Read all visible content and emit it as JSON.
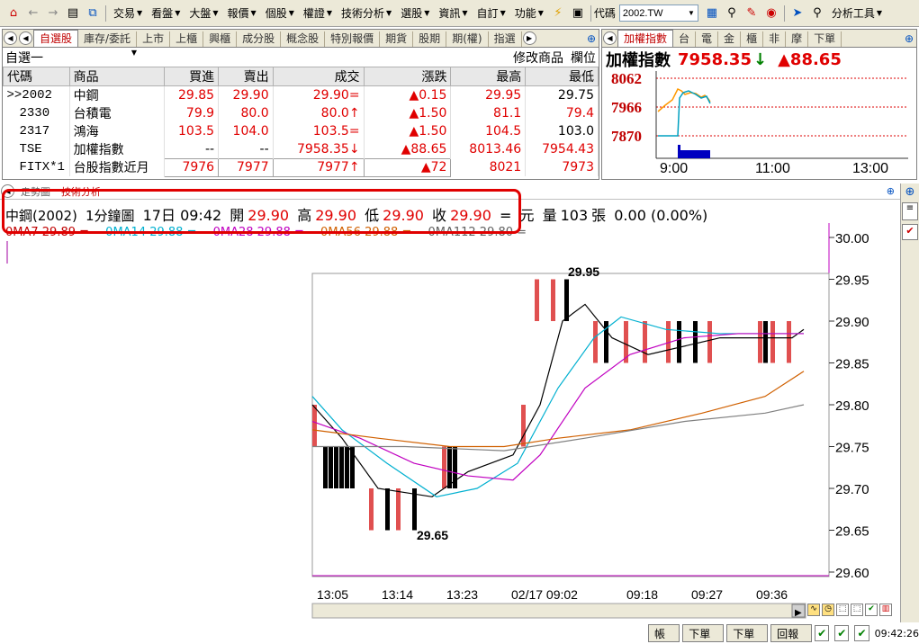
{
  "toolbar": {
    "menus": [
      "交易",
      "看盤",
      "大盤",
      "報價",
      "個股",
      "權證",
      "技術分析",
      "選股",
      "資訊",
      "自訂",
      "功能"
    ],
    "code_label": "代碼",
    "code_value": "2002.TW",
    "tools_label": "分析工具"
  },
  "watchlist": {
    "tabs": [
      "自選股",
      "庫存/委託",
      "上市",
      "上櫃",
      "興櫃",
      "成分股",
      "概念股",
      "特別報價",
      "期貨",
      "股期",
      "期(權)",
      "指選"
    ],
    "group": "自選一",
    "edit_label": "修改商品",
    "column_label": "欄位",
    "headers": [
      "代碼",
      "商品",
      "買進",
      "賣出",
      "成交",
      "漲跌",
      "最高",
      "最低"
    ],
    "rows": [
      {
        "code": ">>2002",
        "name": "中鋼",
        "bid": "29.85",
        "ask": "29.90",
        "last": "29.90=",
        "chg": "▲0.15",
        "high": "29.95",
        "low": "29.75"
      },
      {
        "code": "2330",
        "name": "台積電",
        "bid": "79.9",
        "ask": "80.0",
        "last": "80.0↑",
        "chg": "▲1.50",
        "high": "81.1",
        "low": "79.4"
      },
      {
        "code": "2317",
        "name": "鴻海",
        "bid": "103.5",
        "ask": "104.0",
        "last": "103.5=",
        "chg": "▲1.50",
        "high": "104.5",
        "low": "103.0"
      },
      {
        "code": "TSE",
        "name": "加權指數",
        "bid": "--",
        "ask": "--",
        "last": "7958.35↓",
        "chg": "▲88.65",
        "high": "8013.46",
        "low": "7954.43"
      },
      {
        "code": "FITX*1",
        "name": "台股指數近月",
        "bid": "7976",
        "ask": "7977",
        "last": "7977↑",
        "chg": "▲72",
        "high": "8021",
        "low": "7973"
      }
    ]
  },
  "index": {
    "tabs": [
      "加權指數",
      "台",
      "電",
      "金",
      "櫃",
      "非",
      "摩",
      "下單"
    ],
    "title": "加權指數",
    "value": "7958.35",
    "arrow": "↓",
    "change": "▲88.65",
    "yticks": [
      "8062",
      "7966",
      "7870"
    ],
    "xticks": [
      "9:00",
      "11:00",
      "13:00"
    ]
  },
  "chart": {
    "tabs": [
      "走勢圖",
      "技術分析"
    ],
    "info": {
      "name": "中鋼(2002)",
      "period": "1分鐘圖",
      "date": "17日 09:42",
      "open_label": "開",
      "open": "29.90",
      "high_label": "高",
      "high": "29.90",
      "low_label": "低",
      "low": "29.90",
      "close_label": "收",
      "close": "29.90",
      "eq": "=",
      "unit": "元",
      "vol_label": "量",
      "vol": "103",
      "vol_unit": "張",
      "change": "0.00 (0.00%)"
    },
    "ma": [
      "0MA7 29.89 =",
      "0MA14 29.88 =",
      "0MA28 29.88 =",
      "0MA56 29.88 =",
      "0MA112 29.80 ="
    ],
    "max_label": "29.95",
    "min_label": "29.65"
  },
  "chart_data": {
    "type": "candlestick",
    "title": "",
    "ylim": [
      29.6,
      30.0
    ],
    "yticks": [
      "30.00",
      "29.95",
      "29.90",
      "29.85",
      "29.80",
      "29.75",
      "29.70",
      "29.65",
      "29.60"
    ],
    "xticks": [
      "13:05",
      "13:14",
      "13:23",
      "02/17 09:02",
      "09:18",
      "09:27",
      "09:36"
    ]
  },
  "status": {
    "buttons": [
      "帳務",
      "下單夾",
      "下單列",
      "回報列"
    ],
    "time": "09:42:26"
  }
}
